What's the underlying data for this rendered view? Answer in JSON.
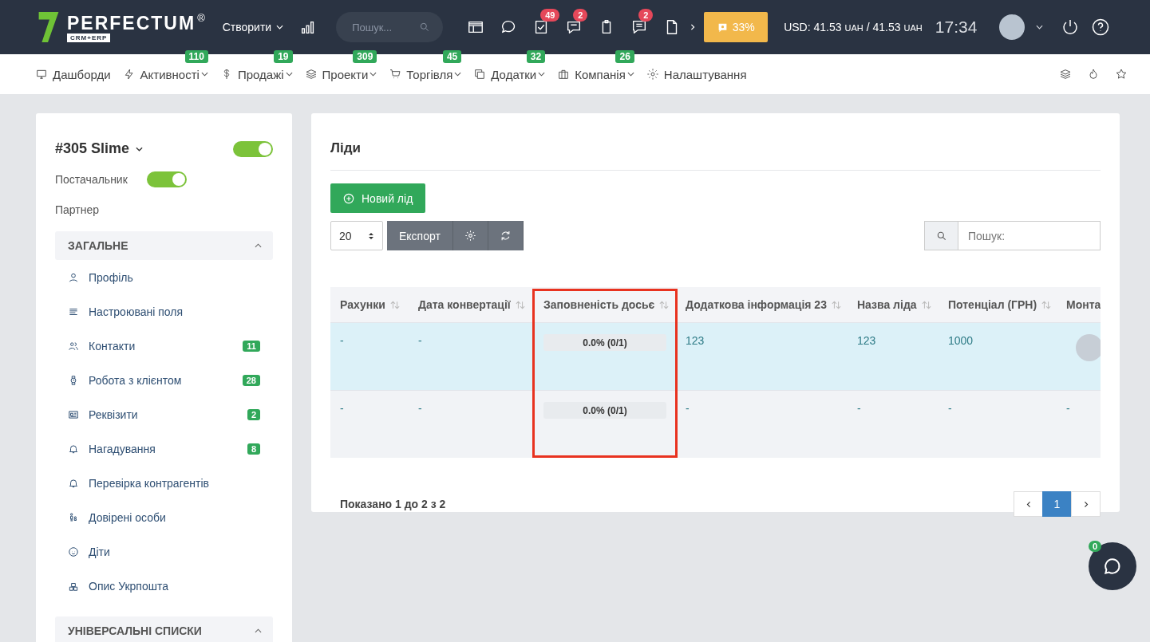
{
  "topbar": {
    "logo": {
      "name": "PERFECTUM",
      "mark": "®",
      "tagline": "CRM+ERP"
    },
    "create": "Створити",
    "search": {
      "placeholder": "Пошук..."
    },
    "toolbar_badges": [
      "49",
      "2",
      "2"
    ],
    "progress": "33%",
    "currency": [
      {
        "kind": "amount",
        "text": "USD: 41.53"
      },
      {
        "kind": "unit",
        "text": "UAH"
      },
      {
        "kind": "amount",
        "text": "/ 41.53"
      },
      {
        "kind": "unit",
        "text": "UAH"
      }
    ],
    "time": "17:34"
  },
  "nav": [
    {
      "label": "Дашборди",
      "dropdown": false
    },
    {
      "label": "Активності",
      "badge": "110",
      "dropdown": true
    },
    {
      "label": "Продажі",
      "badge": "19",
      "dropdown": true
    },
    {
      "label": "Проекти",
      "badge": "309",
      "dropdown": true
    },
    {
      "label": "Торгівля",
      "badge": "45",
      "dropdown": true
    },
    {
      "label": "Додатки",
      "badge": "32",
      "dropdown": true
    },
    {
      "label": "Компанія",
      "badge": "26",
      "dropdown": true
    },
    {
      "label": "Налаштування",
      "dropdown": false
    }
  ],
  "client": {
    "title": "#305 Slime",
    "active": true,
    "flags": [
      {
        "label": "Постачальник",
        "kind": "toggle",
        "on": true
      },
      {
        "label": "Партнер",
        "kind": "text"
      }
    ],
    "sections": [
      {
        "title": "ЗАГАЛЬНЕ",
        "expanded": true,
        "items": [
          {
            "label": "Профіль"
          },
          {
            "label": "Настроювані поля"
          },
          {
            "label": "Контакти",
            "badge": "11"
          },
          {
            "label": "Робота з клієнтом",
            "badge": "28"
          },
          {
            "label": "Реквізити",
            "badge": "2"
          },
          {
            "label": "Нагадування",
            "badge": "8"
          },
          {
            "label": "Перевірка контрагентів"
          },
          {
            "label": "Довірені особи"
          },
          {
            "label": "Діти"
          },
          {
            "label": "Опис Укрпошта"
          }
        ]
      },
      {
        "title": "УНІВЕРСАЛЬНІ СПИСКИ",
        "expanded": true
      }
    ]
  },
  "leads": {
    "title": "Ліди",
    "new_button": "Новий лід",
    "page_size": "20",
    "export_button": "Експорт",
    "search": {
      "placeholder": "Пошук:"
    },
    "table": {
      "columns": [
        {
          "label": "Рахунки",
          "highlighted": false
        },
        {
          "label": "Дата конвертації",
          "highlighted": false
        },
        {
          "label": "Заповненість досьє",
          "highlighted": true
        },
        {
          "label": "Додаткова інформація 23",
          "highlighted": false
        },
        {
          "label": "Назва ліда",
          "highlighted": false
        },
        {
          "label": "Потенціал (ГРН)",
          "highlighted": false
        },
        {
          "label": "Монта",
          "highlighted": false
        }
      ],
      "rows": [
        {
          "selected": true,
          "cells": [
            {
              "kind": "text",
              "text": "-"
            },
            {
              "kind": "text",
              "text": "-"
            },
            {
              "kind": "progress",
              "text": "0.0% (0/1)",
              "level": 0
            },
            {
              "kind": "text",
              "text": "123"
            },
            {
              "kind": "text",
              "text": "123"
            },
            {
              "kind": "text",
              "text": "1000"
            },
            {
              "kind": "avatar"
            }
          ]
        },
        {
          "selected": false,
          "cells": [
            {
              "kind": "text",
              "text": "-"
            },
            {
              "kind": "text",
              "text": "-"
            },
            {
              "kind": "progress",
              "text": "0.0% (0/1)",
              "level": 0
            },
            {
              "kind": "text",
              "text": "-"
            },
            {
              "kind": "text",
              "text": "-"
            },
            {
              "kind": "text",
              "text": "-"
            },
            {
              "kind": "text",
              "text": "-"
            }
          ]
        }
      ]
    },
    "info": "Показано 1 до 2 з 2",
    "pages": [
      {
        "label": "1",
        "selected": true
      }
    ]
  },
  "chat": {
    "badge": "0"
  }
}
